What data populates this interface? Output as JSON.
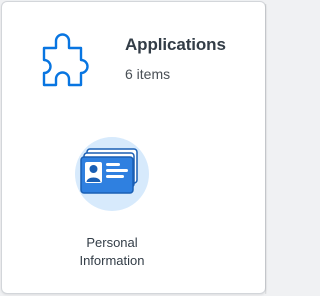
{
  "colors": {
    "accent_blue": "#0875e1",
    "icon_circle": "#d7eafc",
    "text_primary": "#333d47"
  },
  "header": {
    "icon": "puzzle-icon",
    "title": "Applications",
    "count_label": "6 items"
  },
  "apps": [
    {
      "icon": "id-card-icon",
      "label_line1": "Personal",
      "label_line2": "Information"
    }
  ]
}
